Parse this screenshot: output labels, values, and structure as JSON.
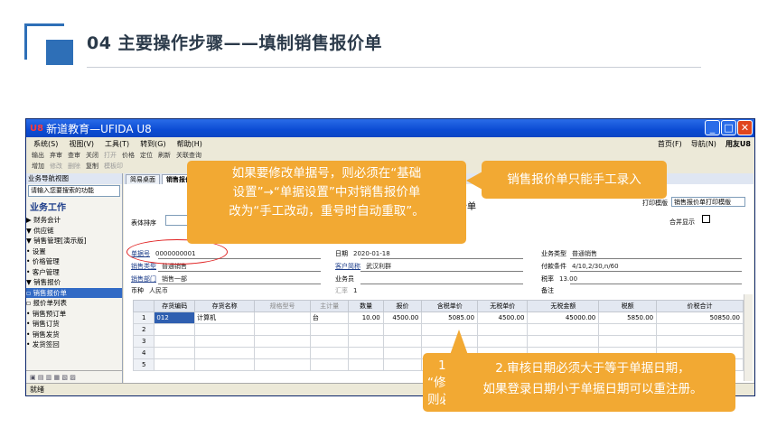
{
  "slide": {
    "title": "04  主要操作步骤——填制销售报价单"
  },
  "window": {
    "title": "新道教育—UFIDA U8",
    "logo": "U8",
    "buttons": [
      "_",
      "□",
      "✕"
    ]
  },
  "menu": {
    "items": [
      "系统(S)",
      "视图(V)",
      "工具(T)",
      "转到(G)",
      "帮助(H)"
    ],
    "right": [
      "首页(F)",
      "导航(N)",
      "用友U8"
    ]
  },
  "toolbar1": [
    "输出",
    "弃审",
    "查审",
    "关闭",
    "打开",
    "价格",
    "定位",
    "刷新",
    "关联查询"
  ],
  "toolbar2": [
    "增加",
    "修改",
    "删除",
    "复制",
    "模板印"
  ],
  "nav": {
    "header": "业务导航视图",
    "search_placeholder": "请输入您要搜索的功能",
    "section": "业务工作",
    "items": [
      "▶ 财务会计",
      "▼ 供应链",
      "  ▼ 销售管理[演示版]",
      "    • 设置",
      "    • 价格管理",
      "    • 客户管理",
      "    ▼ 销售报价",
      "      ▫ 销售报价单",
      "      ▫ 报价单列表",
      "    • 销售预订单",
      "    • 销售订货",
      "    • 销售发货",
      "    • 发货签回"
    ],
    "selected_index": 7
  },
  "tabs": [
    "简易桌面",
    "销售报价单"
  ],
  "form": {
    "title": "销售报价单",
    "print_template_label": "打印模版",
    "print_template_value": "销售报价单打印模版",
    "sort_label": "表体排序",
    "merge_label": "合并显示",
    "fields": {
      "doc_no_label": "单据号",
      "doc_no": "0000000001",
      "date_label": "日期",
      "date": "2020-01-18",
      "biz_type_label": "业务类型",
      "biz_type": "普通销售",
      "sale_type_label": "销售类型",
      "sale_type": "普通销售",
      "customer_label": "客户简称",
      "customer": "武汉利群",
      "pay_terms_label": "付款条件",
      "pay_terms": "4/10,2/30,n/60",
      "dept_label": "销售部门",
      "dept": "销售一部",
      "salesman_label": "业务员",
      "salesman": "",
      "tax_rate_label": "税率",
      "tax_rate": "13.00",
      "currency_label": "币种",
      "currency": "人民币",
      "rate_label": "汇率",
      "rate": "1",
      "remark_label": "备注",
      "remark": ""
    }
  },
  "grid": {
    "headers": [
      "",
      "存货编码",
      "存货名称",
      "规格型号",
      "主计量",
      "数量",
      "报价",
      "含税单价",
      "无税单价",
      "无税金额",
      "税额",
      "价税合计"
    ],
    "rows": [
      [
        "1",
        "012",
        "计算机",
        "",
        "台",
        "10.00",
        "4500.00",
        "5085.00",
        "4500.00",
        "45000.00",
        "5850.00",
        "50850.00"
      ],
      [
        "2",
        "",
        "",
        "",
        "",
        "",
        "",
        "",
        "",
        "",
        "",
        ""
      ],
      [
        "3",
        "",
        "",
        "",
        "",
        "",
        "",
        "",
        "",
        "",
        "",
        ""
      ],
      [
        "4",
        "",
        "",
        "",
        "",
        "",
        "",
        "",
        "",
        "",
        "",
        ""
      ],
      [
        "5",
        "",
        "",
        "",
        "",
        "",
        "",
        "",
        "",
        "",
        "",
        ""
      ]
    ]
  },
  "status_bar": "就绪",
  "callouts": {
    "c1_lines": [
      "如果要修改单据号，则必须在“基础",
      "设置”→“单据设置”中对销售报价单",
      "改为“手工改动，重号时自动重取”。"
    ],
    "c2": "销售报价单只能手工录入",
    "c3_lines": [
      "2.审核日期必须大于等于单据日期，",
      "如果登录日期小于单据日期可以重注册。"
    ],
    "c3_back_lines": [
      "1",
      "“修",
      "则必"
    ]
  }
}
